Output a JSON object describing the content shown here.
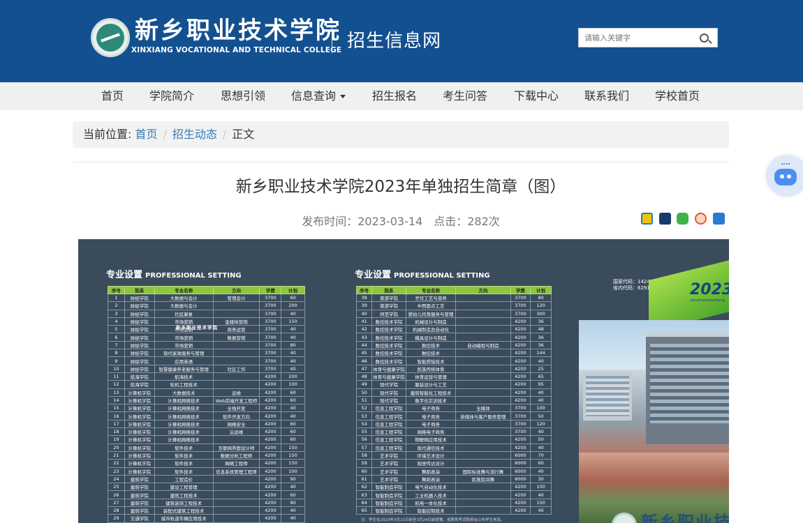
{
  "header": {
    "logo_cn": "新乡职业技术学院",
    "logo_en": "XINXIANG VOCATIONAL AND TECHNICAL COLLEGE",
    "site_name": "招生信息网",
    "search_placeholder": "请输入关键字",
    "bg_color": "#135090"
  },
  "nav": {
    "items": [
      "首页",
      "学院简介",
      "思想引领",
      "信息查询",
      "招生报名",
      "考生问答",
      "下载中心",
      "联系我们",
      "学校首页"
    ]
  },
  "breadcrumb": {
    "prefix": "当前位置:",
    "home": "首页",
    "section": "招生动态",
    "current": "正文"
  },
  "article": {
    "title": "新乡职业技术学院2023年单独招生简章（图）",
    "publish_time": "发布时间：2023-03-14",
    "clicks": "点击：282次",
    "share_icons": [
      "qzone-icon",
      "qq-icon",
      "wechat-icon",
      "weibo-icon",
      "renren-icon"
    ]
  },
  "poster": {
    "heading_cn": "专业设置",
    "heading_en": "PROFESSIONAL SETTING",
    "columns": [
      "序号",
      "院系",
      "专业名称",
      "方向",
      "学费",
      "计划"
    ],
    "codes": [
      "国家代码：14245",
      "省内代码：6291"
    ],
    "year": "2023",
    "year_sub": "danzhaojianzhang",
    "building_name": "新乡职业技术学院",
    "footer_name": "新乡职业技",
    "left_rows": [
      [
        "1",
        "财经学院",
        "大数据与会计",
        "管理会计",
        "3700",
        "60"
      ],
      [
        "2",
        "财经学院",
        "大数据与会计",
        "",
        "3700",
        "200"
      ],
      [
        "3",
        "财经学院",
        "社区康复",
        "",
        "3700",
        "40"
      ],
      [
        "4",
        "财经学院",
        "市场营销",
        "金媒体营销",
        "3700",
        "150"
      ],
      [
        "5",
        "财经学院",
        "市场营销",
        "商务运营",
        "3700",
        "40"
      ],
      [
        "6",
        "财经学院",
        "市场营销",
        "数据营销",
        "3700",
        "40"
      ],
      [
        "7",
        "财经学院",
        "市场营销",
        "",
        "3700",
        "80"
      ],
      [
        "8",
        "财经学院",
        "现代家政服务与管理",
        "",
        "3700",
        "40"
      ],
      [
        "9",
        "财经学院",
        "应用英语",
        "",
        "3700",
        "40"
      ],
      [
        "10",
        "财经学院",
        "智慧健康养老服务与管理",
        "社区工作",
        "3700",
        "40"
      ],
      [
        "11",
        "航海学院",
        "航海技术",
        "",
        "4200",
        "200"
      ],
      [
        "12",
        "航海学院",
        "轮机工程技术",
        "",
        "4200",
        "100"
      ],
      [
        "13",
        "计算机学院",
        "大数据技术",
        "运维",
        "4200",
        "60"
      ],
      [
        "14",
        "计算机学院",
        "计算机网络技术",
        "Web前端开发工程师",
        "4200",
        "60"
      ],
      [
        "15",
        "计算机学院",
        "计算机网络技术",
        "全栈开发",
        "4200",
        "40"
      ],
      [
        "16",
        "计算机学院",
        "计算机网络技术",
        "软件开发方向",
        "4200",
        "40"
      ],
      [
        "17",
        "计算机学院",
        "计算机网络技术",
        "网络安全",
        "4200",
        "60"
      ],
      [
        "18",
        "计算机学院",
        "计算机网络技术",
        "云运维",
        "4200",
        "60"
      ],
      [
        "19",
        "计算机学院",
        "计算机网络技术",
        "",
        "4200",
        "60"
      ],
      [
        "20",
        "计算机学院",
        "软件技术",
        "互联网界面设计师",
        "4200",
        "150"
      ],
      [
        "21",
        "计算机学院",
        "软件技术",
        "数据分析工程师",
        "4200",
        "150"
      ],
      [
        "22",
        "计算机学院",
        "软件技术",
        "网络工程师",
        "4200",
        "150"
      ],
      [
        "23",
        "计算机学院",
        "软件技术",
        "信息系统管理工程师",
        "4200",
        "100"
      ],
      [
        "24",
        "建筑学院",
        "工程造价",
        "",
        "4200",
        "90"
      ],
      [
        "25",
        "建筑学院",
        "建设工程管理",
        "",
        "4200",
        "40"
      ],
      [
        "26",
        "建筑学院",
        "建筑工程技术",
        "",
        "4200",
        "60"
      ],
      [
        "27",
        "建筑学院",
        "建筑装饰工程技术",
        "",
        "4200",
        "90"
      ],
      [
        "28",
        "建筑学院",
        "装配式建筑工程技术",
        "",
        "4200",
        "40"
      ],
      [
        "29",
        "交通学院",
        "城市轨道车辆应用技术",
        "",
        "4200",
        "40"
      ]
    ],
    "right_rows": [
      [
        "38",
        "旅游学院",
        "烹饪工艺与营养",
        "",
        "3700",
        "80"
      ],
      [
        "39",
        "旅游学院",
        "中西面点工艺",
        "",
        "3700",
        "120"
      ],
      [
        "40",
        "师范学院",
        "婴幼儿托育服务与管理",
        "",
        "3700",
        "300"
      ],
      [
        "41",
        "数控技术学院",
        "机械设计与制造",
        "",
        "4200",
        "36"
      ],
      [
        "42",
        "数控技术学院",
        "机械制造及自动化",
        "",
        "4200",
        "48"
      ],
      [
        "43",
        "数控技术学院",
        "模具设计与制造",
        "",
        "4200",
        "36"
      ],
      [
        "44",
        "数控技术学院",
        "数控技术",
        "自动编程与制造",
        "4200",
        "36"
      ],
      [
        "45",
        "数控技术学院",
        "数控技术",
        "",
        "4200",
        "144"
      ],
      [
        "46",
        "数控技术学院",
        "智能焊接技术",
        "",
        "4200",
        "40"
      ],
      [
        "47",
        "体育与健康学院",
        "民族传统体育",
        "",
        "4200",
        "25"
      ],
      [
        "48",
        "体育与健康学院",
        "体育运营与管理",
        "",
        "4200",
        "65"
      ],
      [
        "49",
        "现代学院",
        "服装设计与工艺",
        "",
        "4200",
        "95"
      ],
      [
        "50",
        "现代学院",
        "建筑智能化工程技术",
        "",
        "4200",
        "40"
      ],
      [
        "51",
        "现代学院",
        "数字化实训技术",
        "",
        "4200",
        "40"
      ],
      [
        "52",
        "信息工程学院",
        "电子商务",
        "全媒体",
        "3700",
        "100"
      ],
      [
        "53",
        "信息工程学院",
        "电子商务",
        "新媒体与客户服务管理",
        "3700",
        "50"
      ],
      [
        "54",
        "信息工程学院",
        "电子商务",
        "",
        "3700",
        "120"
      ],
      [
        "55",
        "信息工程学院",
        "网络电子商务",
        "",
        "3700",
        "40"
      ],
      [
        "56",
        "信息工程学院",
        "物联网应用技术",
        "",
        "4200",
        "50"
      ],
      [
        "57",
        "信息工程学院",
        "现代通信技术",
        "",
        "4200",
        "40"
      ],
      [
        "58",
        "艺术学院",
        "环境艺术设计",
        "",
        "6000",
        "70"
      ],
      [
        "59",
        "艺术学院",
        "视觉传达设计",
        "",
        "6000",
        "60"
      ],
      [
        "60",
        "艺术学院",
        "舞蹈表演",
        "国际标准舞与流行舞",
        "6000",
        "40"
      ],
      [
        "61",
        "艺术学院",
        "舞蹈表演",
        "民族民间舞",
        "6000",
        "30"
      ],
      [
        "62",
        "智能制造学院",
        "电气自动化技术",
        "",
        "4200",
        "100"
      ],
      [
        "63",
        "智能制造学院",
        "工业机器人技术",
        "",
        "4200",
        "40"
      ],
      [
        "64",
        "智能制造学院",
        "机电一体化技术",
        "",
        "4200",
        "150"
      ],
      [
        "65",
        "智能制造学院",
        "智能控制技术",
        "",
        "4200",
        "40"
      ]
    ],
    "note": "注：学生在2023年3月22日前至3月24日前提报，省教育考试院将会公布学生信息。"
  }
}
